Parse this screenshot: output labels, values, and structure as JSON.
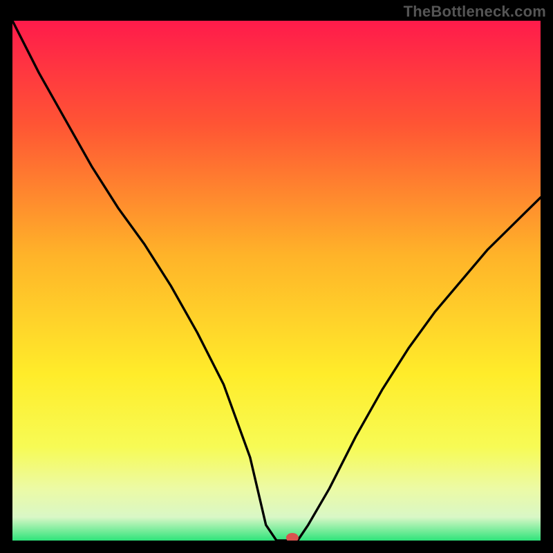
{
  "watermark": {
    "text": "TheBottleneck.com"
  },
  "chart_data": {
    "type": "line",
    "title": "",
    "xlabel": "",
    "ylabel": "",
    "xlim": [
      0,
      100
    ],
    "ylim": [
      0,
      100
    ],
    "x": [
      0,
      5,
      10,
      15,
      20,
      25,
      30,
      35,
      40,
      45,
      48,
      50,
      52,
      54,
      56,
      60,
      65,
      70,
      75,
      80,
      85,
      90,
      95,
      100
    ],
    "values": [
      100,
      90,
      81,
      72,
      64,
      57,
      49,
      40,
      30,
      16,
      3,
      0,
      0,
      0,
      3,
      10,
      20,
      29,
      37,
      44,
      50,
      56,
      61,
      66
    ],
    "marker": {
      "x": 53,
      "y": 0
    },
    "gradient_stops": [
      {
        "offset": 0.0,
        "color": "#ff1b4b"
      },
      {
        "offset": 0.2,
        "color": "#ff5534"
      },
      {
        "offset": 0.45,
        "color": "#ffb329"
      },
      {
        "offset": 0.68,
        "color": "#ffec2a"
      },
      {
        "offset": 0.82,
        "color": "#f7fb55"
      },
      {
        "offset": 0.9,
        "color": "#ecfaa5"
      },
      {
        "offset": 0.955,
        "color": "#d9f7c6"
      },
      {
        "offset": 1.0,
        "color": "#2fe47a"
      }
    ]
  }
}
